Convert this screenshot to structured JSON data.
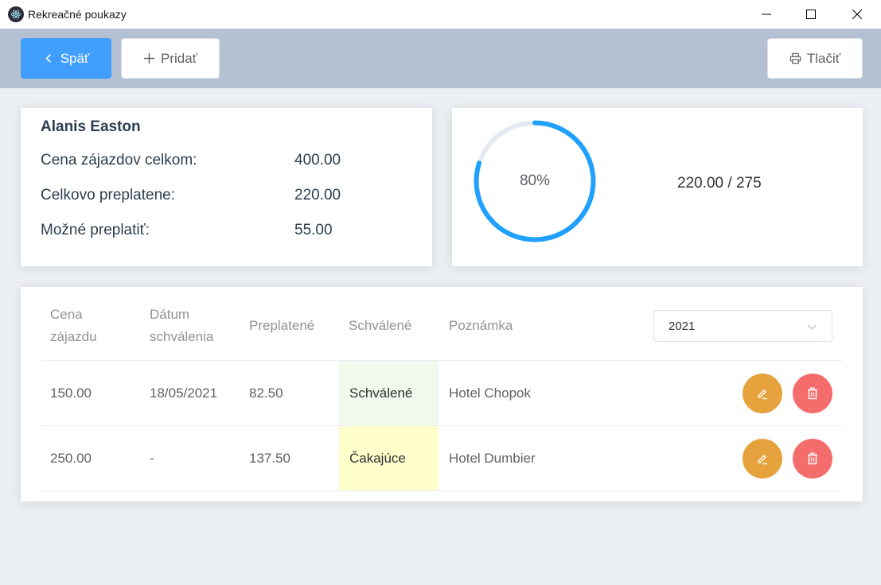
{
  "window": {
    "title": "Rekreačné poukazy"
  },
  "toolbar": {
    "back_label": "Späť",
    "add_label": "Pridať",
    "print_label": "Tlačiť"
  },
  "info": {
    "name": "Alanis Easton",
    "rows": [
      {
        "label": "Cena zájazdov celkom:",
        "value": "400.00"
      },
      {
        "label": "Celkovo preplatene:",
        "value": "220.00"
      },
      {
        "label": "Možné preplatiť:",
        "value": "55.00"
      }
    ]
  },
  "progress": {
    "percent_text": "80%",
    "percent_value": 80,
    "summary": "220.00 / 275",
    "color": "#20a0ff",
    "track_color": "#e5e9f2"
  },
  "table": {
    "headers": {
      "price_line1": "Cena",
      "price_line2": "zájazdu",
      "date_line1": "Dátum",
      "date_line2": "schválenia",
      "reimbursed": "Preplatené",
      "approved": "Schválené",
      "note": "Poznámka"
    },
    "year_select": "2021",
    "rows": [
      {
        "price": "150.00",
        "date": "18/05/2021",
        "reimbursed": "82.50",
        "status": "Schválené",
        "note": "Hotel Chopok"
      },
      {
        "price": "250.00",
        "date": "-",
        "reimbursed": "137.50",
        "status": "Čakajúce",
        "note": "Hotel Dumbier"
      }
    ]
  },
  "colors": {
    "primary": "#409eff",
    "warning": "#e6a23c",
    "danger": "#f56c6c",
    "toolbar_bg": "#b4c1d3"
  },
  "icons": {
    "app": "electron-icon",
    "back": "chevron-left-icon",
    "add": "plus-icon",
    "print": "printer-icon",
    "edit": "edit-icon",
    "delete": "trash-icon",
    "select": "chevron-down-icon"
  }
}
